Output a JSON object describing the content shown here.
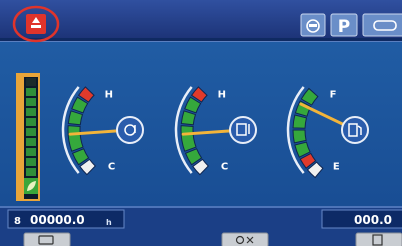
{
  "top_bar": {
    "indicators": [
      {
        "name": "alert-icon",
        "active": true,
        "color": "#e0342b"
      },
      {
        "name": "engine-oil-icon",
        "text": ""
      },
      {
        "name": "parking-brake-indicator",
        "text": "P"
      },
      {
        "name": "lock-indicator",
        "text": ""
      }
    ]
  },
  "gauges": [
    {
      "name": "coolant-temperature-gauge",
      "icon": "coolant-temp-icon",
      "high_label": "H",
      "low_label": "C",
      "level_fraction": 0.45
    },
    {
      "name": "hydraulic-oil-temperature-gauge",
      "icon": "hydraulic-temp-icon",
      "high_label": "H",
      "low_label": "C",
      "level_fraction": 0.45
    },
    {
      "name": "fuel-level-gauge",
      "icon": "fuel-icon",
      "high_label": "F",
      "low_label": "E",
      "level_fraction": 0.82
    }
  ],
  "eco_gauge": {
    "icon": "eco-leaf-icon",
    "segments_total": 10,
    "segments_lit": 9
  },
  "bottom_bar": {
    "hour_meter": "00000.0",
    "hour_unit": "h",
    "odometer": "000.0",
    "softkeys": [
      {
        "name": "softkey-1",
        "icon": "softkey-1-icon"
      },
      {
        "name": "softkey-3",
        "icon": "softkey-3-icon"
      },
      {
        "name": "softkey-5",
        "icon": "softkey-5-icon"
      }
    ]
  },
  "colors": {
    "background": "#1a4c95",
    "title_bar": "#233a86",
    "needle": "#f2b43a",
    "gauge_green": "#35a83c",
    "gauge_red": "#e03a2b"
  }
}
